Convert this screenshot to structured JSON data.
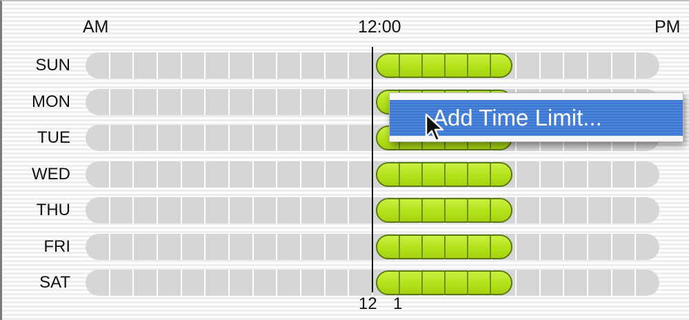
{
  "header": {
    "am_label": "AM",
    "noon_label": "12:00",
    "pm_label": "PM"
  },
  "days": [
    "SUN",
    "MON",
    "TUE",
    "WED",
    "THU",
    "FRI",
    "SAT"
  ],
  "grid": {
    "hour_cells": 24,
    "limit_start_hour": 12,
    "limit_end_hour": 18
  },
  "footer": {
    "tick_12": "12",
    "tick_1": "1"
  },
  "context_menu": {
    "item_label": "Add Time Limit..."
  },
  "colors": {
    "limit_fill": "#b2e21a",
    "limit_border": "#5a7a12",
    "track_fill": "#d6d6d6",
    "menu_highlight": "#3a76cf"
  },
  "icons": {
    "cursor": "arrow-pointer-icon"
  }
}
